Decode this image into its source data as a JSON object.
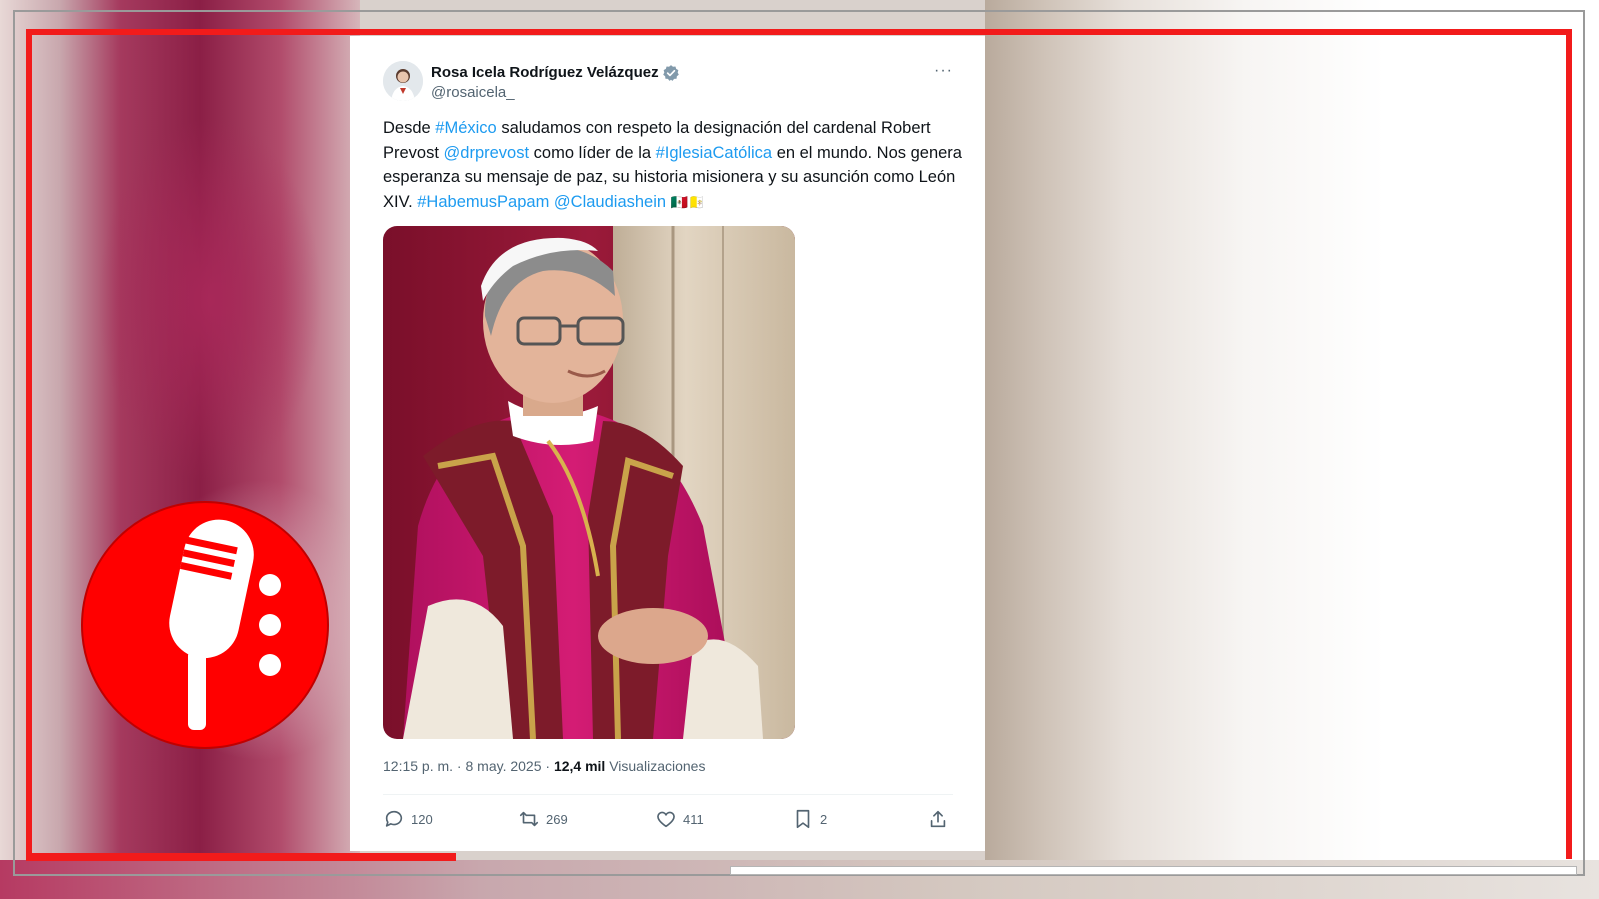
{
  "tweet": {
    "author_name": "Rosa Icela Rodríguez Velázquez",
    "author_handle": "@rosaicela_",
    "more_label": "···",
    "text_parts": {
      "p1": "Desde ",
      "tag_mexico": "#México",
      "p2": " saludamos con respeto la designación del cardenal Robert Prevost ",
      "mention_prevost": "@drprevost",
      "p3": " como líder de la ",
      "tag_iglesia": "#IglesiaCatólica",
      "p4": " en el mundo. Nos genera esperanza su mensaje de paz, su historia misionera y su asunción como León XIV. ",
      "tag_habemus": "#HabemusPapam",
      "mention_claudia": "@Claudiashein",
      "flags": "🇲🇽🇻🇦"
    },
    "timestamp": "12:15 p. m. · 8 may. 2025 · ",
    "views_count": "12,4 mil",
    "views_label": " Visualizaciones",
    "actions": {
      "replies": "120",
      "reposts": "269",
      "likes": "411",
      "bookmarks": "2"
    }
  },
  "colors": {
    "link": "#1d9bf0",
    "frame_red": "#f21b1b",
    "logo_red": "#ff0000"
  },
  "icons": [
    "verified-badge-icon",
    "more-icon",
    "reply-icon",
    "repost-icon",
    "like-icon",
    "bookmark-icon",
    "share-icon",
    "microphone-logo-icon"
  ]
}
